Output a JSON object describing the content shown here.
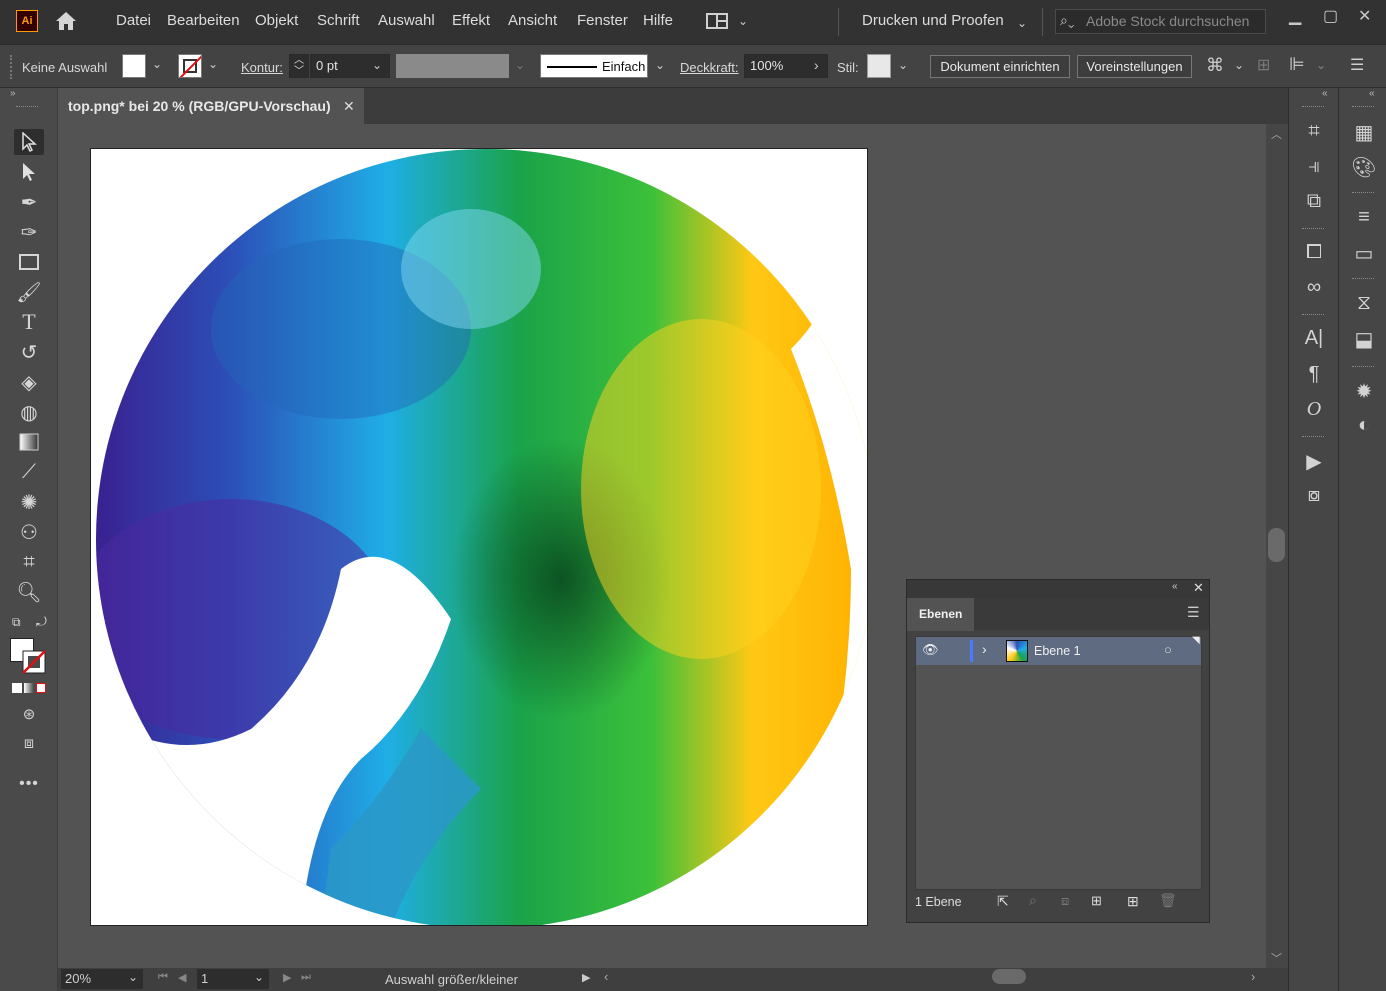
{
  "app": {
    "logo_text": "Ai"
  },
  "menu": {
    "items": [
      "Datei",
      "Bearbeiten",
      "Objekt",
      "Schrift",
      "Auswahl",
      "Effekt",
      "Ansicht",
      "Fenster",
      "Hilfe"
    ],
    "workspace": "Drucken und Proofen",
    "search_placeholder": "Adobe Stock durchsuchen"
  },
  "controlbar": {
    "selection": "Keine Auswahl",
    "stroke_label": "Kontur:",
    "stroke_value": "0 pt",
    "brush_label": "Einfach",
    "opacity_label": "Deckkraft:",
    "opacity_value": "100%",
    "style_label": "Stil:",
    "doc_setup": "Dokument einrichten",
    "preferences": "Voreinstellungen",
    "fill_color": "#ffffff",
    "stroke_color": "none"
  },
  "document": {
    "tab_title": "top.png* bei 20 % (RGB/GPU-Vorschau)",
    "artboard_color": "#ffffff"
  },
  "status": {
    "zoom": "20%",
    "artboard_index": "1",
    "message": "Auswahl größer/kleiner"
  },
  "layers": {
    "panel_title": "Ebenen",
    "rows": [
      {
        "name": "Ebene 1",
        "visible": true,
        "color": "#4b78ff"
      }
    ],
    "footer_count": "1 Ebene"
  }
}
